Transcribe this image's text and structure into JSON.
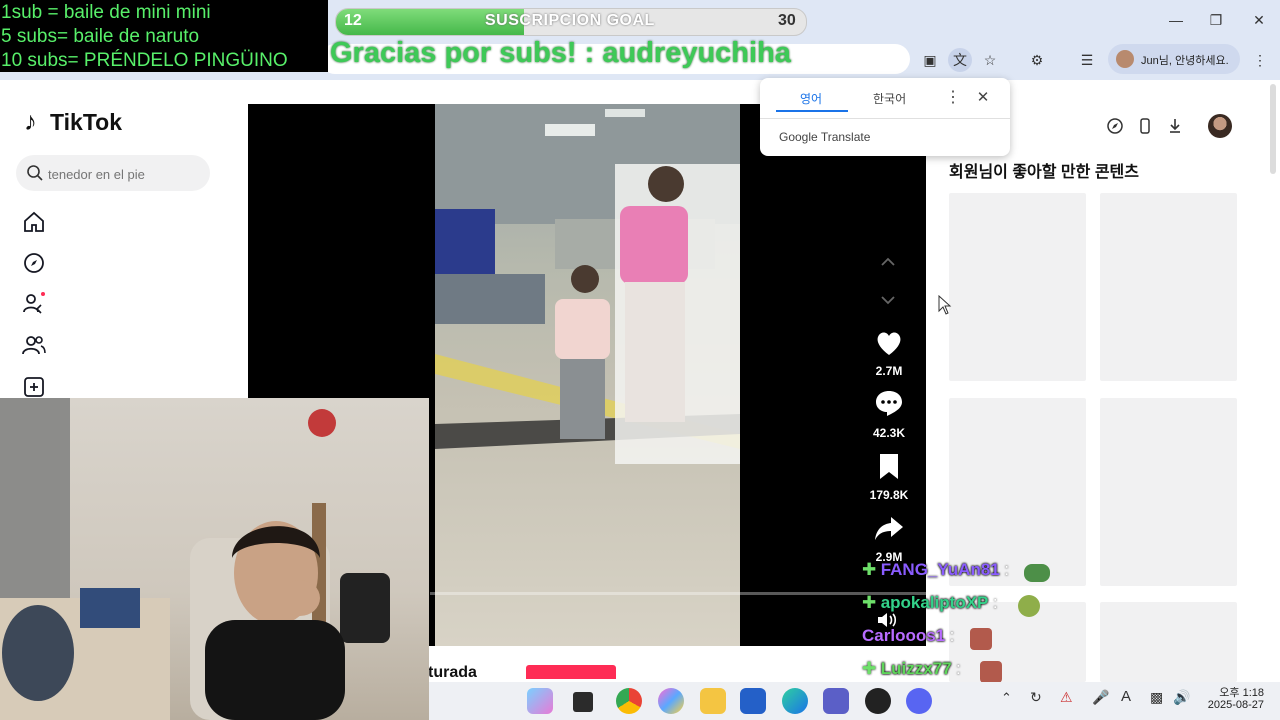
{
  "overlay": {
    "subs_lines": [
      "1sub = baile de mini mini",
      "5 subs= baile de naruto",
      "10 subs= PRÉNDELO PINGÜINO"
    ],
    "goal": {
      "current": "12",
      "label": "SUSCRIPCION GOAL",
      "max": "30",
      "fill_fraction": 0.4
    },
    "thanks": "Gracias por subs! : audreyuchiha"
  },
  "browser": {
    "profile_label": "Jun님, 안녕하세요.",
    "translate": {
      "tab_source": "영어",
      "tab_target": "한국어",
      "brand": "Google Translate"
    }
  },
  "tiktok": {
    "logo": "TikTok",
    "search_placeholder": "tenedor en el pie",
    "actions": {
      "likes": "2.7M",
      "comments": "42.3K",
      "saves": "179.8K",
      "shares": "2.9M"
    },
    "caption_partial": "turada",
    "recommend_title": "회원님이 좋아할 만한 콘텐츠"
  },
  "chat": [
    {
      "name": "FANG_YuAn81",
      "color": "#8a5cff",
      "badge": true
    },
    {
      "name": "apokaliptoXP",
      "color": "#33d28a",
      "badge": true
    },
    {
      "name": "Carlooos1",
      "color": "#b86cff",
      "badge": false
    },
    {
      "name": "Luizzx77",
      "color": "#5ed65a",
      "badge": true
    }
  ],
  "chat_separator": ":",
  "taskbar": {
    "time": "오후 1:18",
    "date": "2025-08-27"
  },
  "colors": {
    "accent": "#fe2c55",
    "overlay_green": "#58f06a",
    "chrome_bg": "#dfe7f5"
  }
}
